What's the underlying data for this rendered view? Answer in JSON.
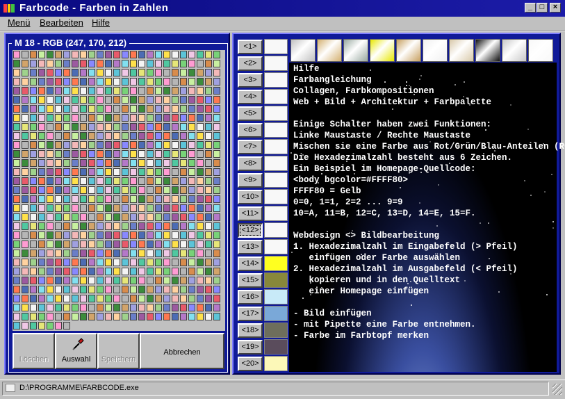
{
  "window": {
    "title": "Farbcode  -  Farben in Zahlen",
    "minimize": "_",
    "maximize": "□",
    "close": "×"
  },
  "menu": [
    "Menü",
    "Bearbeiten",
    "Hilfe"
  ],
  "left_panel": {
    "color_label": "M 18  -  RGB (247, 170, 212)",
    "buttons": {
      "loeschen": "Löschen",
      "auswahl": "Auswahl",
      "speichern": "Speichern",
      "abbrechen": "Abbrechen"
    },
    "palette": [
      "#ff9bd2",
      "#82e0f0",
      "#9fd28c",
      "#b6b6b6",
      "#ffe14a",
      "#6a7ec8",
      "#d88c4c",
      "#f4f4f4",
      "#9c5aa0",
      "#c8f0a0",
      "#5cc4d8",
      "#e85a6a",
      "#3c8c3c",
      "#f0c8e6",
      "#8888ff",
      "#d2a46a",
      "#50c8a0",
      "#ff7850",
      "#a0a0e0",
      "#e6e678",
      "#4c6cb4",
      "#f4b8b8",
      "#78d278",
      "#b478c8",
      "#ffd2a0"
    ]
  },
  "right_panel": {
    "buttons": [
      "<1>",
      "<2>",
      "<3>",
      "<4>",
      "<5>",
      "<6>",
      "<7>",
      "<8>",
      "<9>",
      "<10>",
      "<11>",
      "<12>",
      "<13>",
      "<14>",
      "<15>",
      "<16>",
      "<17>",
      "<18>",
      "<19>",
      "<20>"
    ],
    "swatch_colors": [
      "#f8f8f8",
      "#f8f8f8",
      "#f8f8f8",
      "#f8f8f8",
      "#f8f8f8",
      "#f8f8f8",
      "#f8f8f8",
      "#f8f8f8",
      "#f8f8f8",
      "#f8f8f8",
      "#f8f8f8",
      "#f8f8f8",
      "#f8f8f8",
      "#ffff20",
      "#88883a",
      "#c8eaf8",
      "#7aa8d8",
      "#6e6e5c",
      "#5a4c5c",
      "#fcf8b8"
    ],
    "textures": [
      "#c0c0c0",
      "#d4b070",
      "#98a8a0",
      "#e8e800",
      "#c8a060",
      "#f0f0f0",
      "#d8c8a8",
      "#101010",
      "#c8c8c8",
      "#f8f8f8"
    ],
    "help_text": "Hilfe\nFarbangleichung\nCollagen, Farbkompositionen\nWeb + Bild + Architektur + Farbpalette\n\nEinige Schalter haben zwei Funktionen:\nLinke Maustaste / Rechte Maustaste\nMischen sie eine Farbe aus Rot/Grün/Blau-Anteilen (RGB).\nDie Hexadezimalzahl besteht aus 6 Zeichen.\nEin Beispiel im Homepage-Quellcode:\n<body bgcolor=#FFFF80>\nFFFF80 = Gelb\n0=0, 1=1, 2=2 ... 9=9\n10=A, 11=B, 12=C, 13=D, 14=E, 15=F.\n\nWebdesign <> Bildbearbeitung\n1. Hexadezimalzahl im Eingabefeld (> Pfeil)\n   einfügen oder Farbe auswählen\n2. Hexadezimalzahl im Ausgabefeld (< Pfeil)\n   kopieren und in den Quelltext\n   einer Homepage einfügen\n\n- Bild einfügen\n- mit Pipette eine Farbe entnehmen.\n- Farbe im Farbtopf merken"
  },
  "status": {
    "path": "D:\\PROGRAMME\\FARBCODE.exe"
  }
}
